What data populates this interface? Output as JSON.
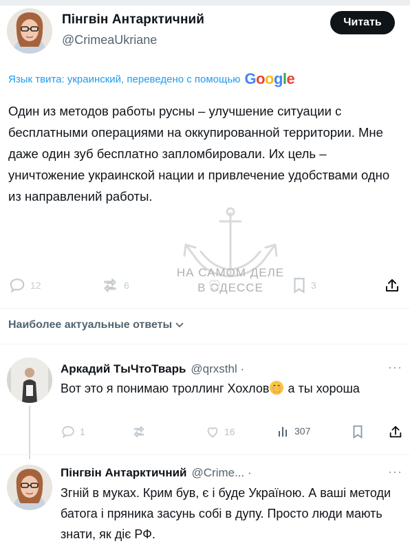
{
  "main_tweet": {
    "author_name": "Пінгвін Антарктичний",
    "author_handle": "@CrimeaUkriane",
    "follow_label": "Читать",
    "translation_note": "Язык твита: украинский, переведено с помощью",
    "translation_provider": "Google",
    "text": "Один из методов работы русны – улучшение ситуации с бесплатными операциями на оккупированной территории. Мне даже один зуб бесплатно запломбировали. Их цель – уничтожение украинской нации и привлечение удобствами одно из направлений работы.",
    "stats": {
      "replies": "12",
      "retweets": "6",
      "likes": "",
      "bookmarks": "3"
    }
  },
  "watermark": {
    "line1": "НА САМОМ ДЕЛЕ",
    "line2": "В ОДЕССЕ"
  },
  "section": {
    "relevant_label": "Наиболее актуальные ответы"
  },
  "replies": [
    {
      "author_name": "Аркадий ТыЧтоТварь",
      "author_handle": "@qrxsthl ·",
      "more": "···",
      "text_before_emoji": "Вот это я понимаю троллинг Хохлов",
      "text_after_emoji": " а ты хороша",
      "emoji_name": "face-with-hand-over-mouth",
      "stats": {
        "replies": "1",
        "retweets": "",
        "likes": "16",
        "views": "307"
      }
    },
    {
      "author_name": "Пінгвін Антарктичний",
      "author_handle": "@Crime... ·",
      "more": "···",
      "text": "Згній в муках. Крим був, є і буде Україною. А ваші методи батога і пряника засунь собі в дупу. Просто люди мають знати, як діє РФ."
    }
  ],
  "colors": {
    "accent": "#1d9bf0",
    "text": "#0f1419",
    "secondary": "#536471",
    "button": "#0f1419"
  }
}
